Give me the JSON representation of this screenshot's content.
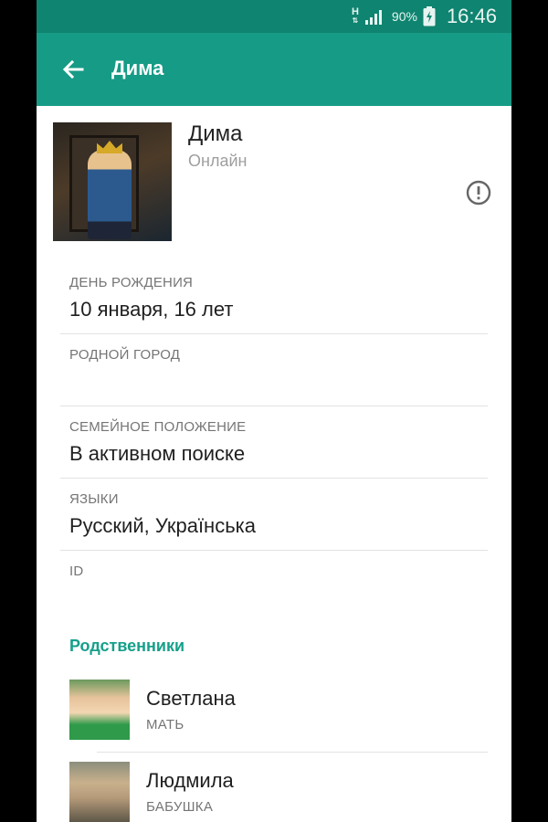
{
  "status_bar": {
    "network": "H",
    "network_arrows": "⇅",
    "battery": "90%",
    "time": "16:46"
  },
  "appbar": {
    "title": "Дима"
  },
  "profile": {
    "name": "Дима",
    "status": "Онлайн"
  },
  "info": [
    {
      "label": "ДЕНЬ РОЖДЕНИЯ",
      "value": "10 января, 16 лет"
    },
    {
      "label": "РОДНОЙ ГОРОД",
      "value": ""
    },
    {
      "label": "СЕМЕЙНОЕ ПОЛОЖЕНИЕ",
      "value": "В активном поиске"
    },
    {
      "label": "ЯЗЫКИ",
      "value": "Русский, Українська"
    },
    {
      "label": "ID",
      "value": ""
    }
  ],
  "relatives": {
    "title": "Родственники",
    "items": [
      {
        "name": "Светлана",
        "role": "МАТЬ"
      },
      {
        "name": "Людмила",
        "role": "БАБУШКА"
      }
    ]
  },
  "colors": {
    "status_bar": "#0f8470",
    "appbar": "#169b86",
    "accent": "#16a08a"
  },
  "icons": [
    "back-arrow-icon",
    "report-icon",
    "signal-icon",
    "battery-icon"
  ]
}
